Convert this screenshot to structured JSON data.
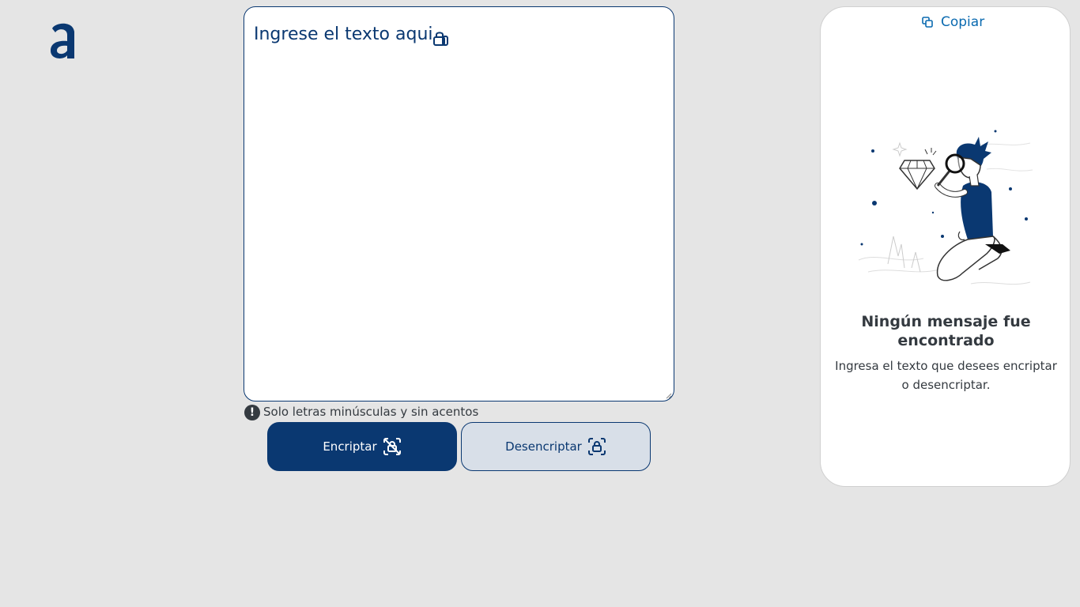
{
  "brand": {
    "logo_icon": "alura-logo-icon",
    "color": "#0a3871"
  },
  "editor": {
    "placeholder": "Ingrese el texto aqui",
    "value": "",
    "icon": "lock-icon"
  },
  "hint": {
    "icon": "exclamation-circle-icon",
    "text": "Solo letras minúsculas y sin acentos"
  },
  "actions": {
    "encrypt_label": "Encriptar",
    "encrypt_icon": "lock-scan-off-icon",
    "decrypt_label": "Desencriptar",
    "decrypt_icon": "lock-scan-icon"
  },
  "output": {
    "copy_label": "Copiar",
    "copy_icon": "copy-icon",
    "illustration": "person-with-magnifier-illustration",
    "empty_title": "Ningún mensaje fue encontrado",
    "empty_text": "Ingresa el texto que desees encriptar o desencriptar."
  },
  "colors": {
    "primary": "#0a3871",
    "background": "#e5e5e5",
    "secondary_button": "#d8dfe8",
    "text_dark": "#343a40"
  }
}
